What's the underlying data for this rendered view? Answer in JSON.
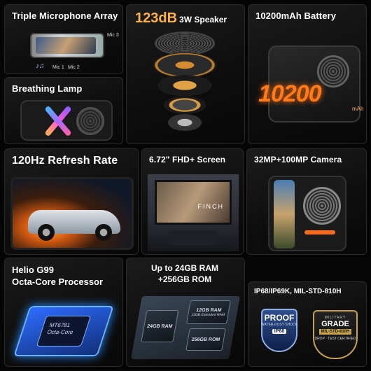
{
  "tiles": {
    "mic": {
      "title": "Triple Microphone Array",
      "labels": {
        "mic1": "Mic 1",
        "mic2": "Mic 2",
        "mic3": "Mic 3"
      }
    },
    "lamp": {
      "title": "Breathing Lamp"
    },
    "speaker": {
      "title_big": "123dB",
      "title_small": "3W Speaker"
    },
    "battery": {
      "title": "10200mAh Battery",
      "number": "10200",
      "unit": "mAh"
    },
    "refresh": {
      "title": "120Hz Refresh Rate"
    },
    "screen": {
      "title": "6.72\" FHD+ Screen",
      "movie_text": "FINCH"
    },
    "camera": {
      "title": "32MP+100MP Camera"
    },
    "cpu": {
      "title_line1": "Helio G99",
      "title_line2": "Octa-Core Processor",
      "chip_line1": "MT6781",
      "chip_line2": "Octa-Core"
    },
    "ram": {
      "title_line1": "Up to 24GB RAM",
      "title_line2": "+256GB ROM",
      "chip1": "24GB RAM",
      "chip2": "12GB RAM",
      "chip2_sub": "12GB Extended RAM",
      "chip3": "256GB ROM"
    },
    "ip": {
      "title": "IP68/IP69K, MIL-STD-810H",
      "shield_line1": "PROOF",
      "shield_line2": "WATER·DUST·SHOCK",
      "shield_line3": "IP68",
      "badge_line0": "MILITARY",
      "badge_line1": "GRADE",
      "badge_line2": "MIL-STD-810H",
      "badge_line3": "DROP · TEST CERTIFIED"
    }
  },
  "colors": {
    "accent": "#ff7a1a",
    "speaker_accent": "#ffb24a",
    "chip_blue": "#2e6cff"
  }
}
